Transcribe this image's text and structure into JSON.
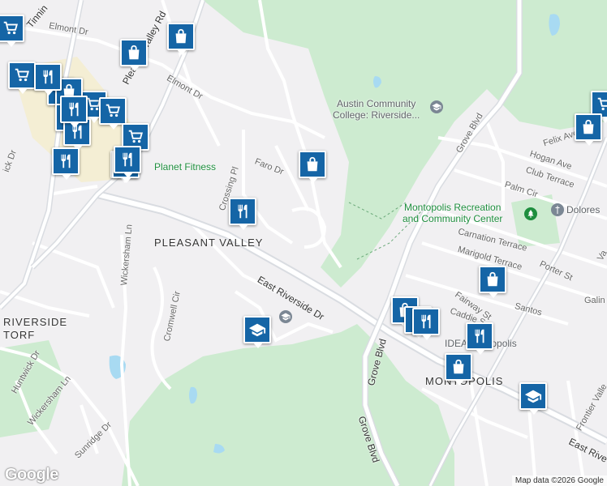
{
  "colors": {
    "pin": "#1565a6",
    "park": "#cdebd0",
    "water": "#a8daf2",
    "road": "#ffffff",
    "arterial": "#d9dce1",
    "plaza": "#f5ecc7"
  },
  "road_labels": [
    {
      "text": "Elmont Dr",
      "name": "label-elmont-dr-north"
    },
    {
      "text": "Elmont Dr",
      "name": "label-elmont-dr-south"
    },
    {
      "text": "Pleasant Valley Rd",
      "name": "label-pleasant-valley-rd"
    },
    {
      "text": "Tinnin",
      "name": "label-tinnin"
    },
    {
      "text": "Faro Dr",
      "name": "label-faro-dr"
    },
    {
      "text": "Crossing Pl",
      "name": "label-crossing-pl"
    },
    {
      "text": "Wickersham Ln",
      "name": "label-wickersham-ln-north"
    },
    {
      "text": "Wickersham Ln",
      "name": "label-wickersham-ln-south"
    },
    {
      "text": "Cromwell Cir",
      "name": "label-cromwell-cir"
    },
    {
      "text": "Huntwick Dr",
      "name": "label-huntwick-dr"
    },
    {
      "text": "Sunridge Dr",
      "name": "label-sunridge-dr"
    },
    {
      "text": "East Riverside Dr",
      "name": "label-east-riverside-dr"
    },
    {
      "text": "East Rive",
      "name": "label-east-riverside-dr-east"
    },
    {
      "text": "Grove Blvd",
      "name": "label-grove-blvd-north"
    },
    {
      "text": "Grove Blvd",
      "name": "label-grove-blvd-middle"
    },
    {
      "text": "Grove Blvd",
      "name": "label-grove-blvd-south"
    },
    {
      "text": "Felix Ave",
      "name": "label-felix-ave"
    },
    {
      "text": "Hogan Ave",
      "name": "label-hogan-ave"
    },
    {
      "text": "Club Terrace",
      "name": "label-club-terrace"
    },
    {
      "text": "Palm Cir",
      "name": "label-palm-cir"
    },
    {
      "text": "Carnation Terrace",
      "name": "label-carnation-terrace"
    },
    {
      "text": "Marigold Terrace",
      "name": "label-marigold-terrace"
    },
    {
      "text": "Porter St",
      "name": "label-porter-st"
    },
    {
      "text": "Fairway St",
      "name": "label-fairway-st"
    },
    {
      "text": "Caddie S",
      "name": "label-caddie-st"
    },
    {
      "text": "Santos",
      "name": "label-santos"
    },
    {
      "text": "Galin",
      "name": "label-galin"
    },
    {
      "text": "Frontier Valle",
      "name": "label-frontier-valley"
    },
    {
      "text": "Va",
      "name": "label-va"
    },
    {
      "text": "ick Dr",
      "name": "label-ick-dr"
    }
  ],
  "area_labels": [
    {
      "text": "PLEASANT VALLEY",
      "name": "label-pleasant-valley"
    },
    {
      "text": "RIVERSIDE",
      "name": "label-riverside"
    },
    {
      "text": "TORF",
      "name": "label-torf"
    },
    {
      "text": "MONTOPOLIS",
      "name": "label-montopolis"
    }
  ],
  "places": {
    "planet_fitness": "Planet Fitness",
    "acc_line1": "Austin Community",
    "acc_line2": "College: Riverside...",
    "montopolis_line1": "Montopolis Recreation",
    "montopolis_line2": "and Community Center",
    "dolores": "Dolores",
    "idea": "IDEA Montopolis"
  },
  "pins": [
    {
      "kind": "grocery",
      "name": "grocery-pin"
    },
    {
      "kind": "grocery",
      "name": "grocery-pin"
    },
    {
      "kind": "grocery",
      "name": "grocery-pin"
    },
    {
      "kind": "grocery",
      "name": "grocery-pin"
    },
    {
      "kind": "grocery",
      "name": "grocery-pin"
    },
    {
      "kind": "grocery",
      "name": "grocery-pin"
    },
    {
      "kind": "grocery",
      "name": "grocery-pin"
    },
    {
      "kind": "shopping",
      "name": "shopping-pin"
    },
    {
      "kind": "shopping",
      "name": "shopping-pin"
    },
    {
      "kind": "shopping",
      "name": "shopping-pin"
    },
    {
      "kind": "shopping",
      "name": "shopping-pin"
    },
    {
      "kind": "shopping",
      "name": "shopping-pin"
    },
    {
      "kind": "shopping",
      "name": "shopping-pin"
    },
    {
      "kind": "shopping",
      "name": "shopping-pin"
    },
    {
      "kind": "shopping",
      "name": "shopping-pin"
    },
    {
      "kind": "restaurant",
      "name": "restaurant-pin"
    },
    {
      "kind": "restaurant",
      "name": "restaurant-pin"
    },
    {
      "kind": "restaurant",
      "name": "restaurant-pin"
    },
    {
      "kind": "restaurant",
      "name": "restaurant-pin"
    },
    {
      "kind": "restaurant",
      "name": "restaurant-pin"
    },
    {
      "kind": "restaurant",
      "name": "restaurant-pin"
    },
    {
      "kind": "restaurant",
      "name": "restaurant-pin"
    },
    {
      "kind": "restaurant",
      "name": "restaurant-pin"
    },
    {
      "kind": "restaurant",
      "name": "restaurant-pin"
    },
    {
      "kind": "restaurant",
      "name": "restaurant-pin"
    },
    {
      "kind": "restaurant",
      "name": "restaurant-pin"
    },
    {
      "kind": "restaurant",
      "name": "restaurant-pin"
    },
    {
      "kind": "school",
      "name": "school-pin"
    },
    {
      "kind": "school",
      "name": "school-pin"
    }
  ],
  "attribution": "Map data ©2026 Google",
  "logo": "Google"
}
